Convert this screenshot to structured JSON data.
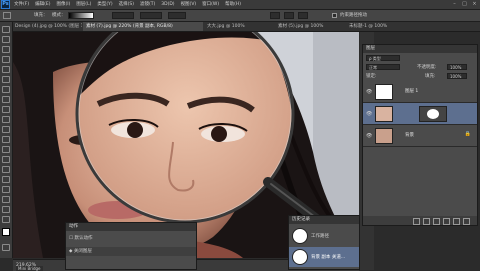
{
  "app": {
    "logo": "Ps"
  },
  "menu": [
    "文件(F)",
    "编辑(E)",
    "图像(I)",
    "图层(L)",
    "类型(Y)",
    "选择(S)",
    "滤镜(T)",
    "3D(D)",
    "视图(V)",
    "窗口(W)",
    "帮助(H)"
  ],
  "window_buttons": [
    "–",
    "□",
    "×"
  ],
  "options_bar": {
    "feather_label": "填充：",
    "mode_label": "模式：",
    "flag_label": "约束路径拖动"
  },
  "tabs": [
    "Design (4).jpg @ 100% (图层 1...",
    "素材 (7).jpg @ 220% (背景 副本, RGB/8)",
    "大大.jpg @ 100%",
    "素材 (5).jpg @ 100%",
    "未标题-1 @ 100%"
  ],
  "status": {
    "zoom": "219.62%",
    "mini_bridge": "Mini Bridge"
  },
  "layers_panel": {
    "title": "图层",
    "filter_label": "ρ 类型",
    "blend_mode": "正常",
    "opacity_label": "不透明度:",
    "opacity": "100%",
    "lock_label": "锁定:",
    "fill_label": "填充:",
    "fill": "100%",
    "layers": [
      {
        "name": "图层 1",
        "visible": true,
        "selected": false
      },
      {
        "name": "",
        "visible": true,
        "selected": true
      },
      {
        "name": "背景",
        "visible": true,
        "selected": false
      }
    ]
  },
  "actions_panel": {
    "title": "动作",
    "items": [
      "默认动作",
      "关闭图层"
    ]
  },
  "history_panel": {
    "title": "历史记录",
    "items": [
      "工作路径",
      "背景 副本 关道..."
    ]
  },
  "colors": {
    "accent": "#2b7ad6",
    "selected_row": "#5d6f8f"
  }
}
